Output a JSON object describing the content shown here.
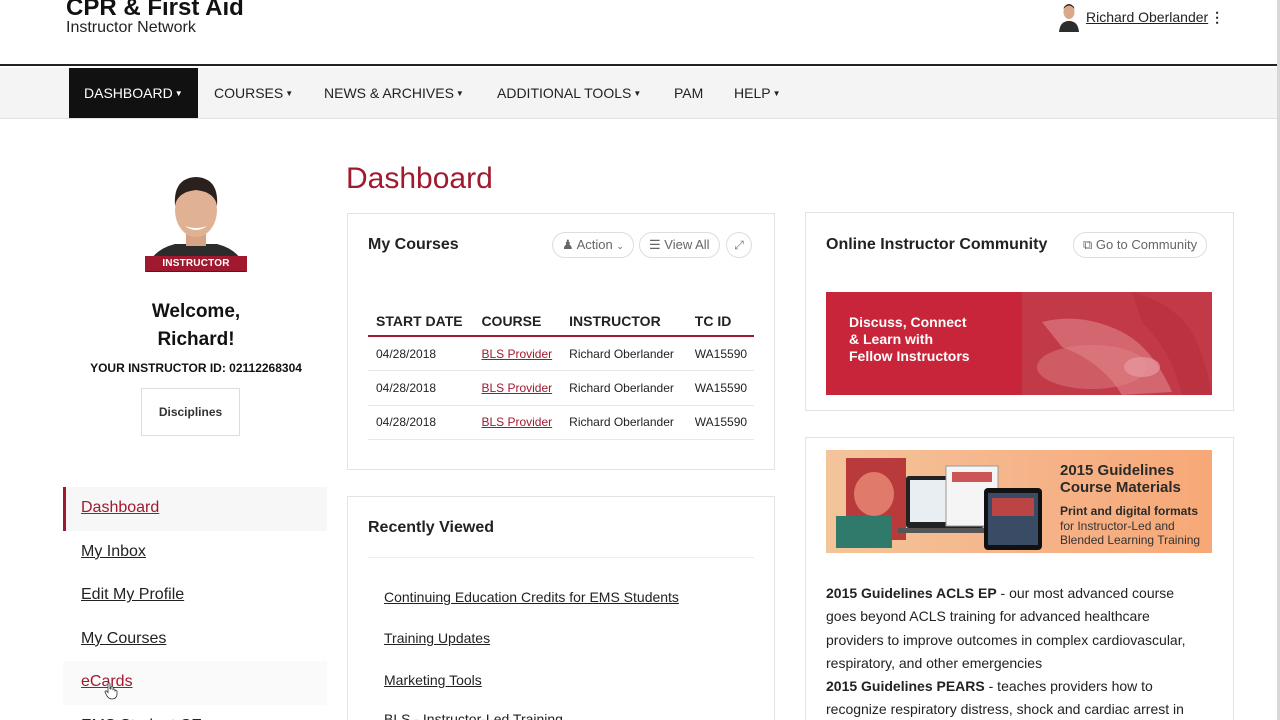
{
  "header": {
    "brand_title": "CPR & First Aid",
    "brand_subtitle": "Instructor Network",
    "user_name": "Richard Oberlander",
    "kebab": "⋮"
  },
  "nav": {
    "items": [
      {
        "label": "DASHBOARD",
        "caret": true,
        "active": true
      },
      {
        "label": "COURSES",
        "caret": true
      },
      {
        "label": "NEWS & ARCHIVES",
        "caret": true
      },
      {
        "label": "ADDITIONAL TOOLS",
        "caret": true
      },
      {
        "label": "PAM",
        "caret": false
      },
      {
        "label": "HELP",
        "caret": true
      }
    ],
    "caret_glyph": "▼"
  },
  "profile": {
    "badge": "INSTRUCTOR",
    "welcome_line1": "Welcome,",
    "welcome_line2": "Richard!",
    "instructor_id": "YOUR INSTRUCTOR ID: 02112268304",
    "disciplines_label": "Disciplines"
  },
  "sidenav": {
    "items": [
      {
        "label": "Dashboard",
        "state": "active"
      },
      {
        "label": "My Inbox"
      },
      {
        "label": "Edit My Profile"
      },
      {
        "label": "My Courses"
      },
      {
        "label": "eCards",
        "state": "hover"
      },
      {
        "label": "EMS Student CE"
      }
    ]
  },
  "main": {
    "title": "Dashboard",
    "my_courses": {
      "title": "My Courses",
      "action_label": "Action",
      "view_all_label": "View All",
      "columns": [
        "START DATE",
        "COURSE",
        "INSTRUCTOR",
        "TC ID"
      ],
      "rows": [
        {
          "start_date": "04/28/2018",
          "course": "BLS Provider",
          "instructor": "Richard Oberlander",
          "tc_id": "WA15590"
        },
        {
          "start_date": "04/28/2018",
          "course": "BLS Provider",
          "instructor": "Richard Oberlander",
          "tc_id": "WA15590"
        },
        {
          "start_date": "04/28/2018",
          "course": "BLS Provider",
          "instructor": "Richard Oberlander",
          "tc_id": "WA15590"
        }
      ]
    },
    "recently_viewed": {
      "title": "Recently Viewed",
      "links": [
        "Continuing Education Credits for EMS Students",
        "Training Updates",
        "Marketing Tools",
        "BLS - Instructor-Led Training"
      ]
    }
  },
  "community": {
    "title": "Online Instructor Community",
    "button_label": "Go to Community",
    "banner_line1": "Discuss, Connect",
    "banner_line2": "& Learn with",
    "banner_line3": "Fellow Instructors"
  },
  "guidelines": {
    "banner_title_line1": "2015 Guidelines",
    "banner_title_line2": "Course Materials",
    "banner_sub1": "Print and digital formats",
    "banner_sub2": "for Instructor-Led and Blended Learning Training",
    "acls_title": "2015 Guidelines ACLS EP",
    "acls_text": " - our most advanced course goes beyond ACLS training for advanced healthcare providers to improve outcomes in complex cardiovascular, respiratory, and other emergencies",
    "pears_title": "2015 Guidelines PEARS",
    "pears_text": " - teaches providers how to recognize respiratory distress, shock and cardiac arrest in"
  },
  "colors": {
    "accent": "#a0192f",
    "nav_active_bg": "#111111",
    "nav_bg": "#f4f4f4",
    "banner_red": "#c8253a"
  },
  "icons": [
    "avatar",
    "kebab-icon",
    "caret-down-icon",
    "user-icon",
    "list-icon",
    "expand-icon",
    "external-link-icon",
    "cursor-icon"
  ]
}
